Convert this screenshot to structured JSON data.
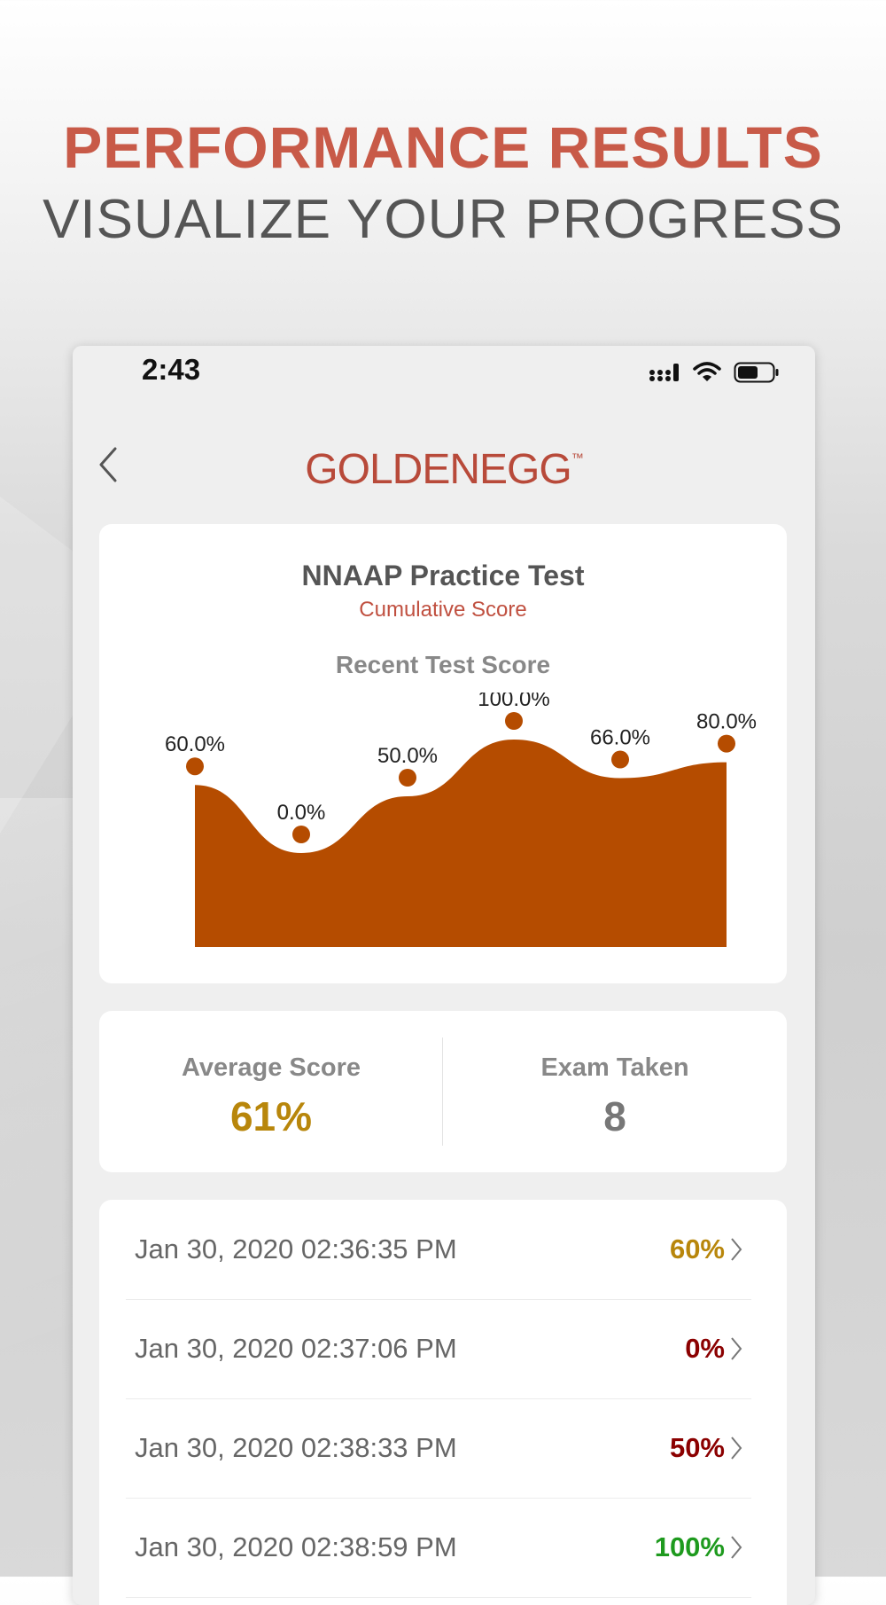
{
  "promo": {
    "line1": "PERFORMANCE RESULTS",
    "line2": "VISUALIZE YOUR PROGRESS"
  },
  "status_bar": {
    "time": "2:43",
    "icons": [
      "cellular-signal-icon",
      "wifi-icon",
      "battery-icon"
    ]
  },
  "header": {
    "back_icon": "chevron-left-icon",
    "logo_text": "GOLDENEGG",
    "logo_mark": "™"
  },
  "chart_card": {
    "title": "NNAAP Practice Test",
    "subtitle": "Cumulative Score",
    "heading": "Recent Test Score"
  },
  "chart_data": {
    "type": "area",
    "x": [
      1,
      2,
      3,
      4,
      5,
      6
    ],
    "values": [
      60.0,
      0.0,
      50.0,
      100.0,
      66.0,
      80.0
    ],
    "labels": [
      "60.0%",
      "0.0%",
      "50.0%",
      "100.0%",
      "66.0%",
      "80.0%"
    ],
    "ylim": [
      0,
      100
    ],
    "grid": false,
    "color": "#b54c00"
  },
  "stats": {
    "average_label": "Average Score",
    "average_value": "61%",
    "exams_label": "Exam Taken",
    "exams_value": "8"
  },
  "attempts": [
    {
      "date": "Jan 30, 2020 02:36:35 PM",
      "score": "60%",
      "color": "#b8860b"
    },
    {
      "date": "Jan 30, 2020 02:37:06 PM",
      "score": "0%",
      "color": "#8b0000"
    },
    {
      "date": "Jan 30, 2020 02:38:33 PM",
      "score": "50%",
      "color": "#8b0000"
    },
    {
      "date": "Jan 30, 2020 02:38:59 PM",
      "score": "100%",
      "color": "#1e9a1e"
    }
  ],
  "colors": {
    "accent": "#c85a48",
    "average_value": "#b8860b",
    "exams_value": "#777777",
    "chart_fill": "#b54c00"
  }
}
